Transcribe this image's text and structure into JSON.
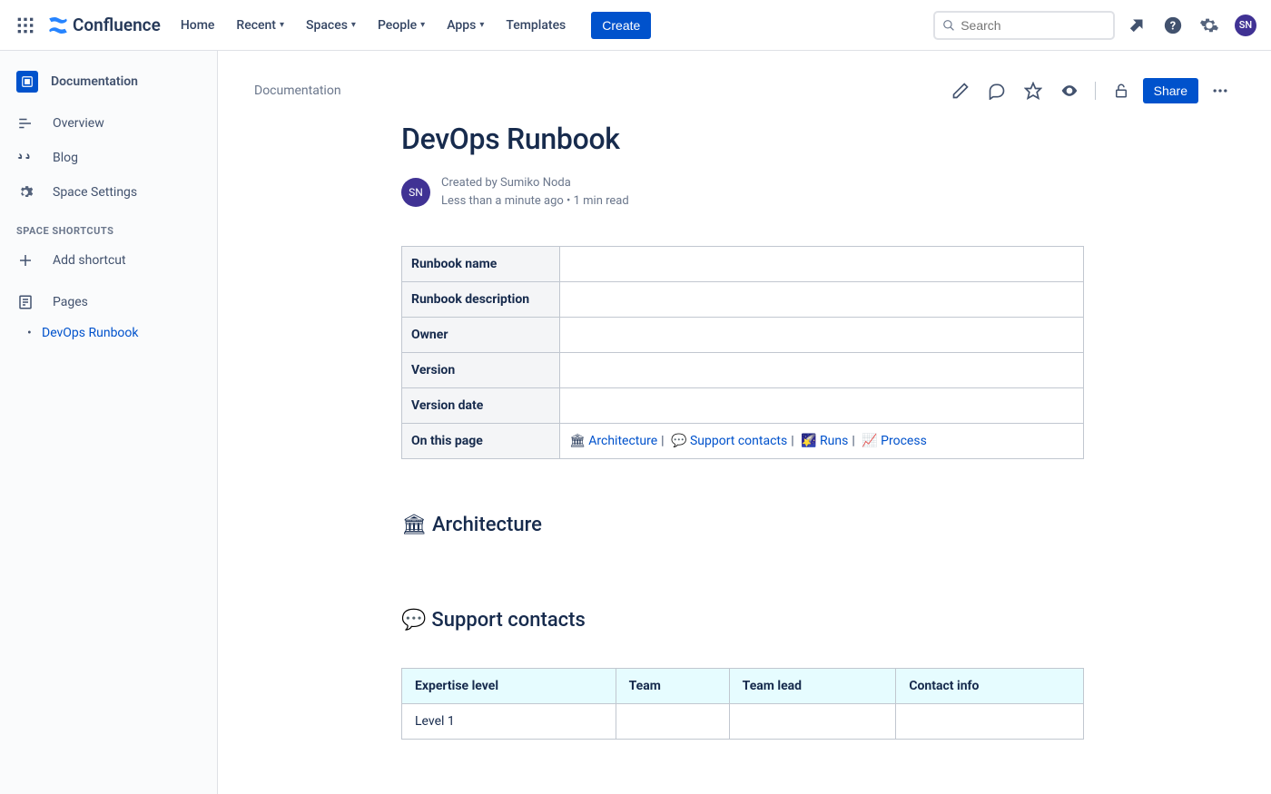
{
  "brand": {
    "name": "Confluence"
  },
  "nav": {
    "home": "Home",
    "recent": "Recent",
    "spaces": "Spaces",
    "people": "People",
    "apps": "Apps",
    "templates": "Templates",
    "create": "Create"
  },
  "search": {
    "placeholder": "Search"
  },
  "avatar_initials": "SN",
  "sidebar": {
    "space": "Documentation",
    "overview": "Overview",
    "blog": "Blog",
    "space_settings": "Space Settings",
    "shortcuts_heading": "SPACE SHORTCUTS",
    "add_shortcut": "Add shortcut",
    "pages": "Pages",
    "tree": {
      "item0": "DevOps Runbook"
    }
  },
  "page": {
    "breadcrumb": "Documentation",
    "share": "Share",
    "title": "DevOps Runbook",
    "byline_author": "Created by Sumiko Noda",
    "byline_meta": "Less than a minute ago •  1 min read",
    "avatar_initials": "SN"
  },
  "meta_table": {
    "r0": "Runbook name",
    "r1": "Runbook description",
    "r2": "Owner",
    "r3": "Version",
    "r4": "Version date",
    "r5": "On this page",
    "toc": {
      "e0": "🏛",
      "l0": "Architecture",
      "e1": "💬",
      "l1": "Support contacts",
      "e2": "🌠",
      "l2": "Runs",
      "e3": "📈",
      "l3": "Process"
    }
  },
  "sections": {
    "arch_emoji": "🏛",
    "arch": "Architecture",
    "support_emoji": "💬",
    "support": "Support contacts"
  },
  "contacts_table": {
    "h0": "Expertise level",
    "h1": "Team",
    "h2": "Team lead",
    "h3": "Contact info",
    "r0c0": "Level 1"
  }
}
